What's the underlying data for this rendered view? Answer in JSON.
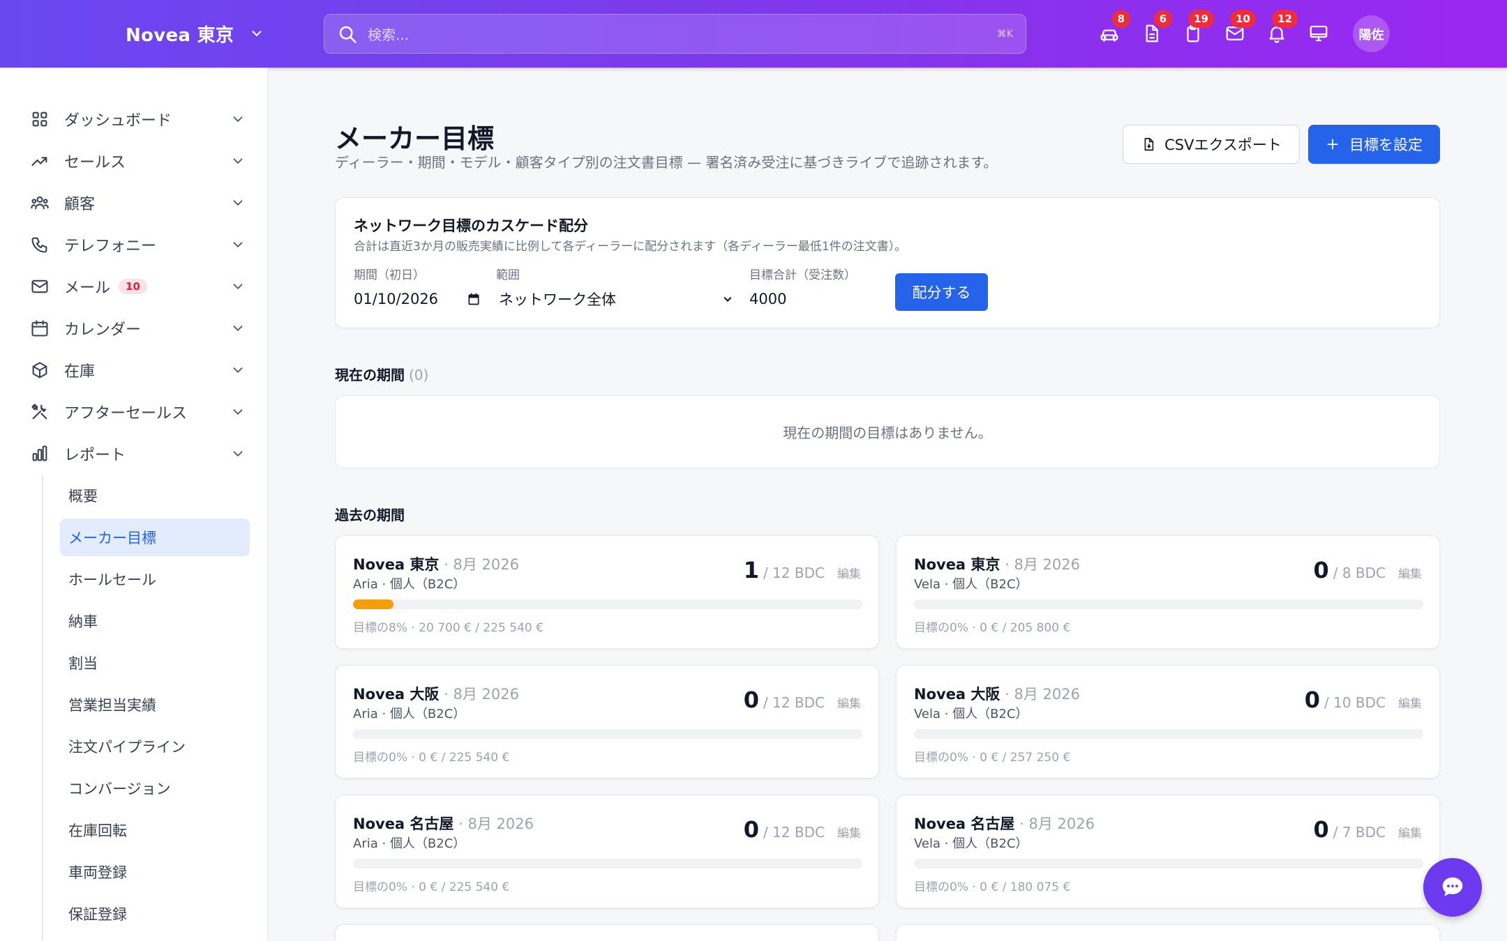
{
  "header": {
    "brand": "Novea 東京",
    "search_placeholder": "検索...",
    "search_shortcut": "⌘K",
    "notifications": [
      {
        "icon": "car-icon",
        "count": "8"
      },
      {
        "icon": "document-icon",
        "count": "6"
      },
      {
        "icon": "clipboard-icon",
        "count": "19"
      },
      {
        "icon": "mail-icon",
        "count": "10"
      },
      {
        "icon": "bell-icon",
        "count": "12"
      }
    ],
    "avatar": "陽佐"
  },
  "sidebar": {
    "items": [
      {
        "label": "ダッシュボード",
        "icon": "grid-icon"
      },
      {
        "label": "セールス",
        "icon": "trend-icon"
      },
      {
        "label": "顧客",
        "icon": "users-icon"
      },
      {
        "label": "テレフォニー",
        "icon": "phone-icon"
      },
      {
        "label": "メール",
        "icon": "mail-icon",
        "badge": "10"
      },
      {
        "label": "カレンダー",
        "icon": "calendar-icon"
      },
      {
        "label": "在庫",
        "icon": "box-icon"
      },
      {
        "label": "アフターセールス",
        "icon": "tools-icon"
      },
      {
        "label": "レポート",
        "icon": "chart-icon"
      }
    ],
    "subitems": [
      "概要",
      "メーカー目標",
      "ホールセール",
      "納車",
      "割当",
      "営業担当実績",
      "注文パイプライン",
      "コンバージョン",
      "在庫回転",
      "車両登録",
      "保証登録"
    ],
    "active_subitem": "メーカー目標"
  },
  "page": {
    "title": "メーカー目標",
    "subtitle": "ディーラー・期間・モデル・顧客タイプ別の注文書目標 — 署名済み受注に基づきライブで追跡されます。",
    "csv_button": "CSVエクスポート",
    "set_button": "目標を設定"
  },
  "cascade": {
    "title": "ネットワーク目標のカスケード配分",
    "description": "合計は直近3か月の販売実績に比例して各ディーラーに配分されます（各ディーラー最低1件の注文書）。",
    "period_label": "期間（初日）",
    "period_value": "01/10/2026",
    "scope_label": "範囲",
    "scope_value": "ネットワーク全体",
    "total_label": "目標合計（受注数）",
    "total_value": "4000",
    "allocate_button": "配分する"
  },
  "current": {
    "title": "現在の期間",
    "count": "(0)",
    "empty": "現在の期間の目標はありません。"
  },
  "past": {
    "title": "過去の期間",
    "edit_label": "編集",
    "cards": [
      {
        "dealer": "Novea 東京",
        "period": "· 8月 2026",
        "model": "Aria · 個人（B2C）",
        "count": "1",
        "target": "/ 12 BDC",
        "progress": 0.08,
        "footer": "目標の8% · 20 700 € / 225 540 €"
      },
      {
        "dealer": "Novea 東京",
        "period": "· 8月 2026",
        "model": "Vela · 個人（B2C）",
        "count": "0",
        "target": "/ 8 BDC",
        "progress": 0,
        "footer": "目標の0% · 0 € / 205 800 €"
      },
      {
        "dealer": "Novea 大阪",
        "period": "· 8月 2026",
        "model": "Aria · 個人（B2C）",
        "count": "0",
        "target": "/ 12 BDC",
        "progress": 0,
        "footer": "目標の0% · 0 € / 225 540 €"
      },
      {
        "dealer": "Novea 大阪",
        "period": "· 8月 2026",
        "model": "Vela · 個人（B2C）",
        "count": "0",
        "target": "/ 10 BDC",
        "progress": 0,
        "footer": "目標の0% · 0 € / 257 250 €"
      },
      {
        "dealer": "Novea 名古屋",
        "period": "· 8月 2026",
        "model": "Aria · 個人（B2C）",
        "count": "0",
        "target": "/ 12 BDC",
        "progress": 0,
        "footer": "目標の0% · 0 € / 225 540 €"
      },
      {
        "dealer": "Novea 名古屋",
        "period": "· 8月 2026",
        "model": "Vela · 個人（B2C）",
        "count": "0",
        "target": "/ 7 BDC",
        "progress": 0,
        "footer": "目標の0% · 0 € / 180 075 €"
      }
    ]
  },
  "colors": {
    "accent": "#2563eb",
    "header_start": "#6a48f0",
    "header_end": "#9b27f0",
    "progress": "#f59e0b",
    "badge": "#ef2d3a"
  }
}
